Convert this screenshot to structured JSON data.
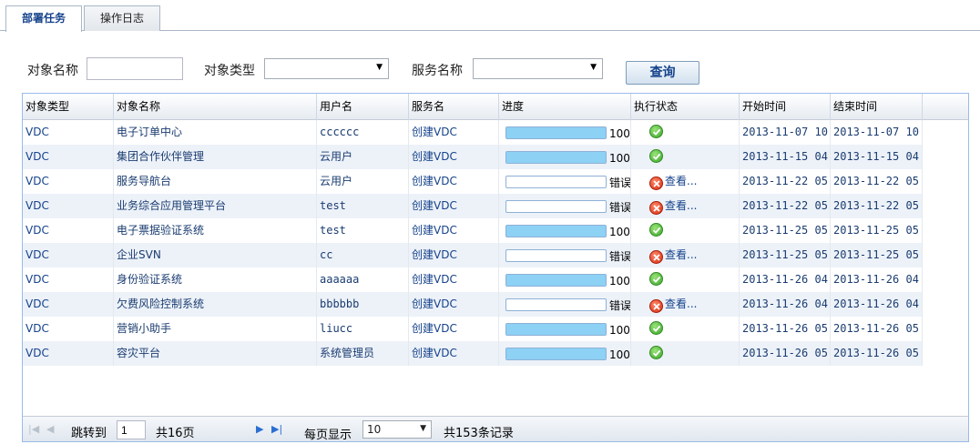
{
  "tabs": [
    {
      "label": "部署任务",
      "active": true
    },
    {
      "label": "操作日志",
      "active": false
    }
  ],
  "search": {
    "object_name_label": "对象名称",
    "object_name_value": "",
    "object_type_label": "对象类型",
    "object_type_value": "",
    "service_name_label": "服务名称",
    "service_name_value": "",
    "query_button": "查询"
  },
  "grid": {
    "columns": [
      "对象类型",
      "对象名称",
      "用户名",
      "服务名",
      "进度",
      "执行状态",
      "开始时间",
      "结束时间"
    ],
    "rows": [
      {
        "type": "VDC",
        "name": "电子订单中心",
        "user": "cccccc",
        "service": "创建VDC",
        "progress": 100,
        "progress_label": "100",
        "status": "ok",
        "status_text": "",
        "start": "2013-11-07 10",
        "end": "2013-11-07 10"
      },
      {
        "type": "VDC",
        "name": "集团合作伙伴管理",
        "user": "云用户",
        "service": "创建VDC",
        "progress": 100,
        "progress_label": "100",
        "status": "ok",
        "status_text": "",
        "start": "2013-11-15 04",
        "end": "2013-11-15 04"
      },
      {
        "type": "VDC",
        "name": "服务导航台",
        "user": "云用户",
        "service": "创建VDC",
        "progress": 0,
        "progress_label": "错误",
        "status": "error",
        "status_text": "查看...",
        "start": "2013-11-22 05",
        "end": "2013-11-22 05"
      },
      {
        "type": "VDC",
        "name": "业务综合应用管理平台",
        "user": "test",
        "service": "创建VDC",
        "progress": 0,
        "progress_label": "错误",
        "status": "error",
        "status_text": "查看...",
        "start": "2013-11-22 05",
        "end": "2013-11-22 05"
      },
      {
        "type": "VDC",
        "name": "电子票据验证系统",
        "user": "test",
        "service": "创建VDC",
        "progress": 100,
        "progress_label": "100",
        "status": "ok",
        "status_text": "",
        "start": "2013-11-25 05",
        "end": "2013-11-25 05"
      },
      {
        "type": "VDC",
        "name": "企业SVN",
        "user": "cc",
        "service": "创建VDC",
        "progress": 0,
        "progress_label": "错误",
        "status": "error",
        "status_text": "查看...",
        "start": "2013-11-25 05",
        "end": "2013-11-25 05"
      },
      {
        "type": "VDC",
        "name": "身份验证系统",
        "user": "aaaaaa",
        "service": "创建VDC",
        "progress": 100,
        "progress_label": "100",
        "status": "ok",
        "status_text": "",
        "start": "2013-11-26 04",
        "end": "2013-11-26 04"
      },
      {
        "type": "VDC",
        "name": "欠费风险控制系统",
        "user": "bbbbbb",
        "service": "创建VDC",
        "progress": 0,
        "progress_label": "错误",
        "status": "error",
        "status_text": "查看...",
        "start": "2013-11-26 04",
        "end": "2013-11-26 04"
      },
      {
        "type": "VDC",
        "name": "营销小助手",
        "user": "liucc",
        "service": "创建VDC",
        "progress": 100,
        "progress_label": "100",
        "status": "ok",
        "status_text": "",
        "start": "2013-11-26 05",
        "end": "2013-11-26 05"
      },
      {
        "type": "VDC",
        "name": "容灾平台",
        "user": "系统管理员",
        "service": "创建VDC",
        "progress": 100,
        "progress_label": "100",
        "status": "ok",
        "status_text": "",
        "start": "2013-11-26 05",
        "end": "2013-11-26 05"
      }
    ]
  },
  "pager": {
    "jump_label": "跳转到",
    "current_page": "1",
    "total_pages": "共16页",
    "per_page_label": "每页显示",
    "per_page_value": "10",
    "total_records": "共153条记录"
  },
  "colors": {
    "link": "#15428b",
    "progress_fill": "#8dd1f5",
    "row_alt": "#edf2f9",
    "grid_border": "#99bbe8"
  },
  "icons": {
    "ok": "check-circle-icon",
    "error": "error-x-circle-icon",
    "first": "first-page-icon",
    "prev": "prev-page-icon",
    "next": "next-page-icon",
    "last": "last-page-icon",
    "dropdown": "chevron-down-icon"
  }
}
